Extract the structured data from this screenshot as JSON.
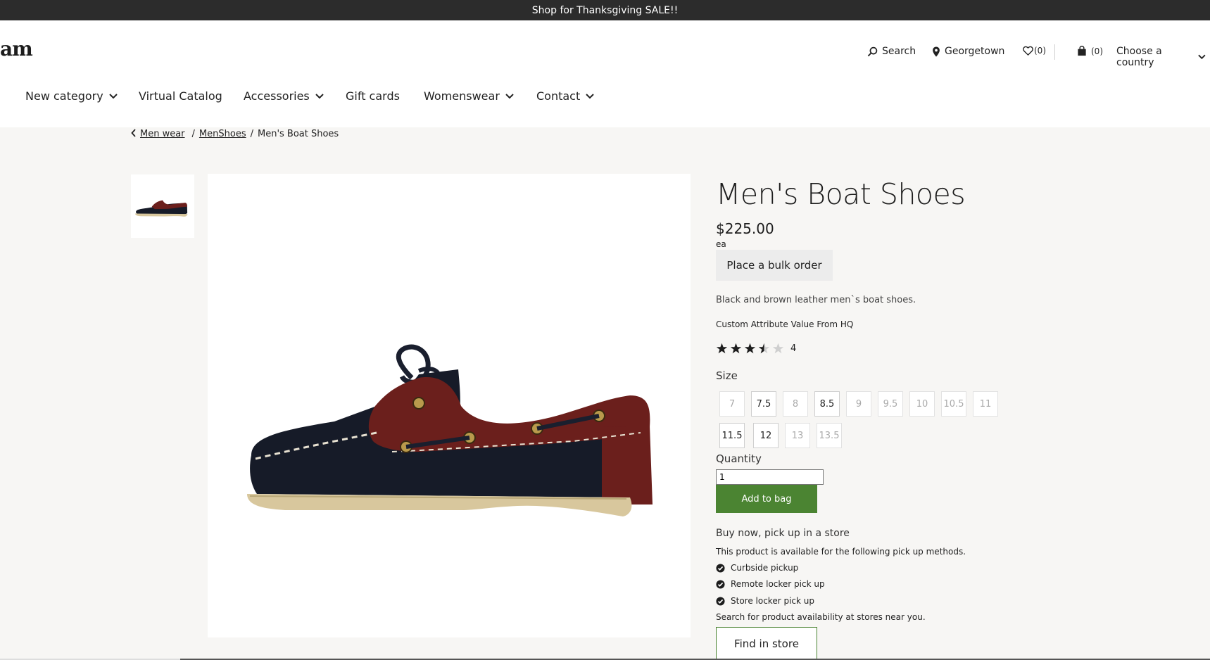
{
  "promo": {
    "text": "Shop for Thanksgiving SALE!!"
  },
  "header": {
    "logo": "am",
    "search_label": "Search",
    "store_label": "Georgetown",
    "wishlist_count": "(0)",
    "cart_count": "(0)",
    "country_label": "Choose a country"
  },
  "nav": {
    "items": [
      {
        "label": "New category",
        "dropdown": true
      },
      {
        "label": "Virtual Catalog",
        "dropdown": false
      },
      {
        "label": "Accessories",
        "dropdown": true
      },
      {
        "label": "Gift cards",
        "dropdown": false
      },
      {
        "label": "Womenswear",
        "dropdown": true
      },
      {
        "label": "Contact",
        "dropdown": true
      }
    ]
  },
  "breadcrumb": {
    "items": [
      "Men wear",
      "MenShoes",
      "Men's Boat Shoes"
    ]
  },
  "product": {
    "title": "Men's Boat Shoes",
    "price": "$225.00",
    "unit": "ea",
    "bulk_order_label": "Place a bulk order",
    "description": "Black and brown leather men`s boat shoes.",
    "custom_attribute": "Custom Attribute Value From HQ",
    "rating": 3.5,
    "rating_count": "4",
    "size_label": "Size",
    "sizes": [
      {
        "label": "7",
        "available": false
      },
      {
        "label": "7.5",
        "available": true
      },
      {
        "label": "8",
        "available": false
      },
      {
        "label": "8.5",
        "available": true
      },
      {
        "label": "9",
        "available": false
      },
      {
        "label": "9.5",
        "available": false
      },
      {
        "label": "10",
        "available": false
      },
      {
        "label": "10.5",
        "available": false
      },
      {
        "label": "11",
        "available": false
      },
      {
        "label": "11.5",
        "available": true
      },
      {
        "label": "12",
        "available": true
      },
      {
        "label": "13",
        "available": false
      },
      {
        "label": "13.5",
        "available": false
      }
    ],
    "quantity_label": "Quantity",
    "quantity_value": "1",
    "add_to_bag_label": "Add to bag"
  },
  "pickup": {
    "title": "Buy now, pick up in a store",
    "description": "This product is available for the following pick up methods.",
    "methods": [
      "Curbside pickup",
      "Remote locker pick up",
      "Store locker pick up"
    ],
    "search_text": "Search for product availability at stores near you.",
    "find_in_store_label": "Find in store"
  },
  "colors": {
    "promo_bar": "#2c2c2c",
    "add_to_bag": "#4b8432",
    "page_bg": "#f7f6f4"
  }
}
